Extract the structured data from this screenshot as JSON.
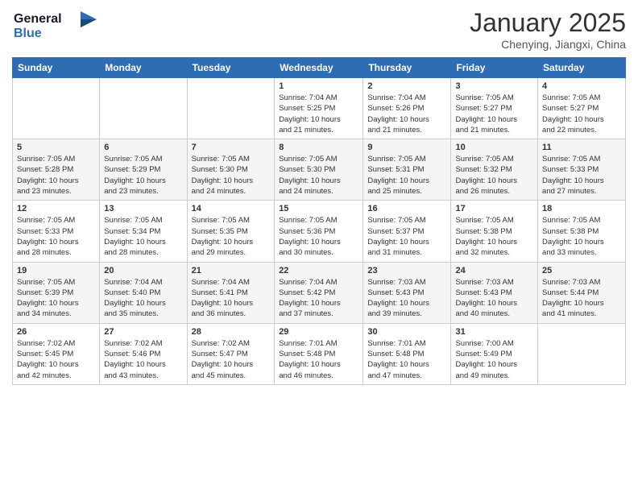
{
  "header": {
    "logo_line1": "General",
    "logo_line2": "Blue",
    "title": "January 2025",
    "location": "Chenying, Jiangxi, China"
  },
  "weekdays": [
    "Sunday",
    "Monday",
    "Tuesday",
    "Wednesday",
    "Thursday",
    "Friday",
    "Saturday"
  ],
  "weeks": [
    [
      {
        "day": "",
        "info": ""
      },
      {
        "day": "",
        "info": ""
      },
      {
        "day": "",
        "info": ""
      },
      {
        "day": "1",
        "info": "Sunrise: 7:04 AM\nSunset: 5:25 PM\nDaylight: 10 hours\nand 21 minutes."
      },
      {
        "day": "2",
        "info": "Sunrise: 7:04 AM\nSunset: 5:26 PM\nDaylight: 10 hours\nand 21 minutes."
      },
      {
        "day": "3",
        "info": "Sunrise: 7:05 AM\nSunset: 5:27 PM\nDaylight: 10 hours\nand 21 minutes."
      },
      {
        "day": "4",
        "info": "Sunrise: 7:05 AM\nSunset: 5:27 PM\nDaylight: 10 hours\nand 22 minutes."
      }
    ],
    [
      {
        "day": "5",
        "info": "Sunrise: 7:05 AM\nSunset: 5:28 PM\nDaylight: 10 hours\nand 23 minutes."
      },
      {
        "day": "6",
        "info": "Sunrise: 7:05 AM\nSunset: 5:29 PM\nDaylight: 10 hours\nand 23 minutes."
      },
      {
        "day": "7",
        "info": "Sunrise: 7:05 AM\nSunset: 5:30 PM\nDaylight: 10 hours\nand 24 minutes."
      },
      {
        "day": "8",
        "info": "Sunrise: 7:05 AM\nSunset: 5:30 PM\nDaylight: 10 hours\nand 24 minutes."
      },
      {
        "day": "9",
        "info": "Sunrise: 7:05 AM\nSunset: 5:31 PM\nDaylight: 10 hours\nand 25 minutes."
      },
      {
        "day": "10",
        "info": "Sunrise: 7:05 AM\nSunset: 5:32 PM\nDaylight: 10 hours\nand 26 minutes."
      },
      {
        "day": "11",
        "info": "Sunrise: 7:05 AM\nSunset: 5:33 PM\nDaylight: 10 hours\nand 27 minutes."
      }
    ],
    [
      {
        "day": "12",
        "info": "Sunrise: 7:05 AM\nSunset: 5:33 PM\nDaylight: 10 hours\nand 28 minutes."
      },
      {
        "day": "13",
        "info": "Sunrise: 7:05 AM\nSunset: 5:34 PM\nDaylight: 10 hours\nand 28 minutes."
      },
      {
        "day": "14",
        "info": "Sunrise: 7:05 AM\nSunset: 5:35 PM\nDaylight: 10 hours\nand 29 minutes."
      },
      {
        "day": "15",
        "info": "Sunrise: 7:05 AM\nSunset: 5:36 PM\nDaylight: 10 hours\nand 30 minutes."
      },
      {
        "day": "16",
        "info": "Sunrise: 7:05 AM\nSunset: 5:37 PM\nDaylight: 10 hours\nand 31 minutes."
      },
      {
        "day": "17",
        "info": "Sunrise: 7:05 AM\nSunset: 5:38 PM\nDaylight: 10 hours\nand 32 minutes."
      },
      {
        "day": "18",
        "info": "Sunrise: 7:05 AM\nSunset: 5:38 PM\nDaylight: 10 hours\nand 33 minutes."
      }
    ],
    [
      {
        "day": "19",
        "info": "Sunrise: 7:05 AM\nSunset: 5:39 PM\nDaylight: 10 hours\nand 34 minutes."
      },
      {
        "day": "20",
        "info": "Sunrise: 7:04 AM\nSunset: 5:40 PM\nDaylight: 10 hours\nand 35 minutes."
      },
      {
        "day": "21",
        "info": "Sunrise: 7:04 AM\nSunset: 5:41 PM\nDaylight: 10 hours\nand 36 minutes."
      },
      {
        "day": "22",
        "info": "Sunrise: 7:04 AM\nSunset: 5:42 PM\nDaylight: 10 hours\nand 37 minutes."
      },
      {
        "day": "23",
        "info": "Sunrise: 7:03 AM\nSunset: 5:43 PM\nDaylight: 10 hours\nand 39 minutes."
      },
      {
        "day": "24",
        "info": "Sunrise: 7:03 AM\nSunset: 5:43 PM\nDaylight: 10 hours\nand 40 minutes."
      },
      {
        "day": "25",
        "info": "Sunrise: 7:03 AM\nSunset: 5:44 PM\nDaylight: 10 hours\nand 41 minutes."
      }
    ],
    [
      {
        "day": "26",
        "info": "Sunrise: 7:02 AM\nSunset: 5:45 PM\nDaylight: 10 hours\nand 42 minutes."
      },
      {
        "day": "27",
        "info": "Sunrise: 7:02 AM\nSunset: 5:46 PM\nDaylight: 10 hours\nand 43 minutes."
      },
      {
        "day": "28",
        "info": "Sunrise: 7:02 AM\nSunset: 5:47 PM\nDaylight: 10 hours\nand 45 minutes."
      },
      {
        "day": "29",
        "info": "Sunrise: 7:01 AM\nSunset: 5:48 PM\nDaylight: 10 hours\nand 46 minutes."
      },
      {
        "day": "30",
        "info": "Sunrise: 7:01 AM\nSunset: 5:48 PM\nDaylight: 10 hours\nand 47 minutes."
      },
      {
        "day": "31",
        "info": "Sunrise: 7:00 AM\nSunset: 5:49 PM\nDaylight: 10 hours\nand 49 minutes."
      },
      {
        "day": "",
        "info": ""
      }
    ]
  ]
}
